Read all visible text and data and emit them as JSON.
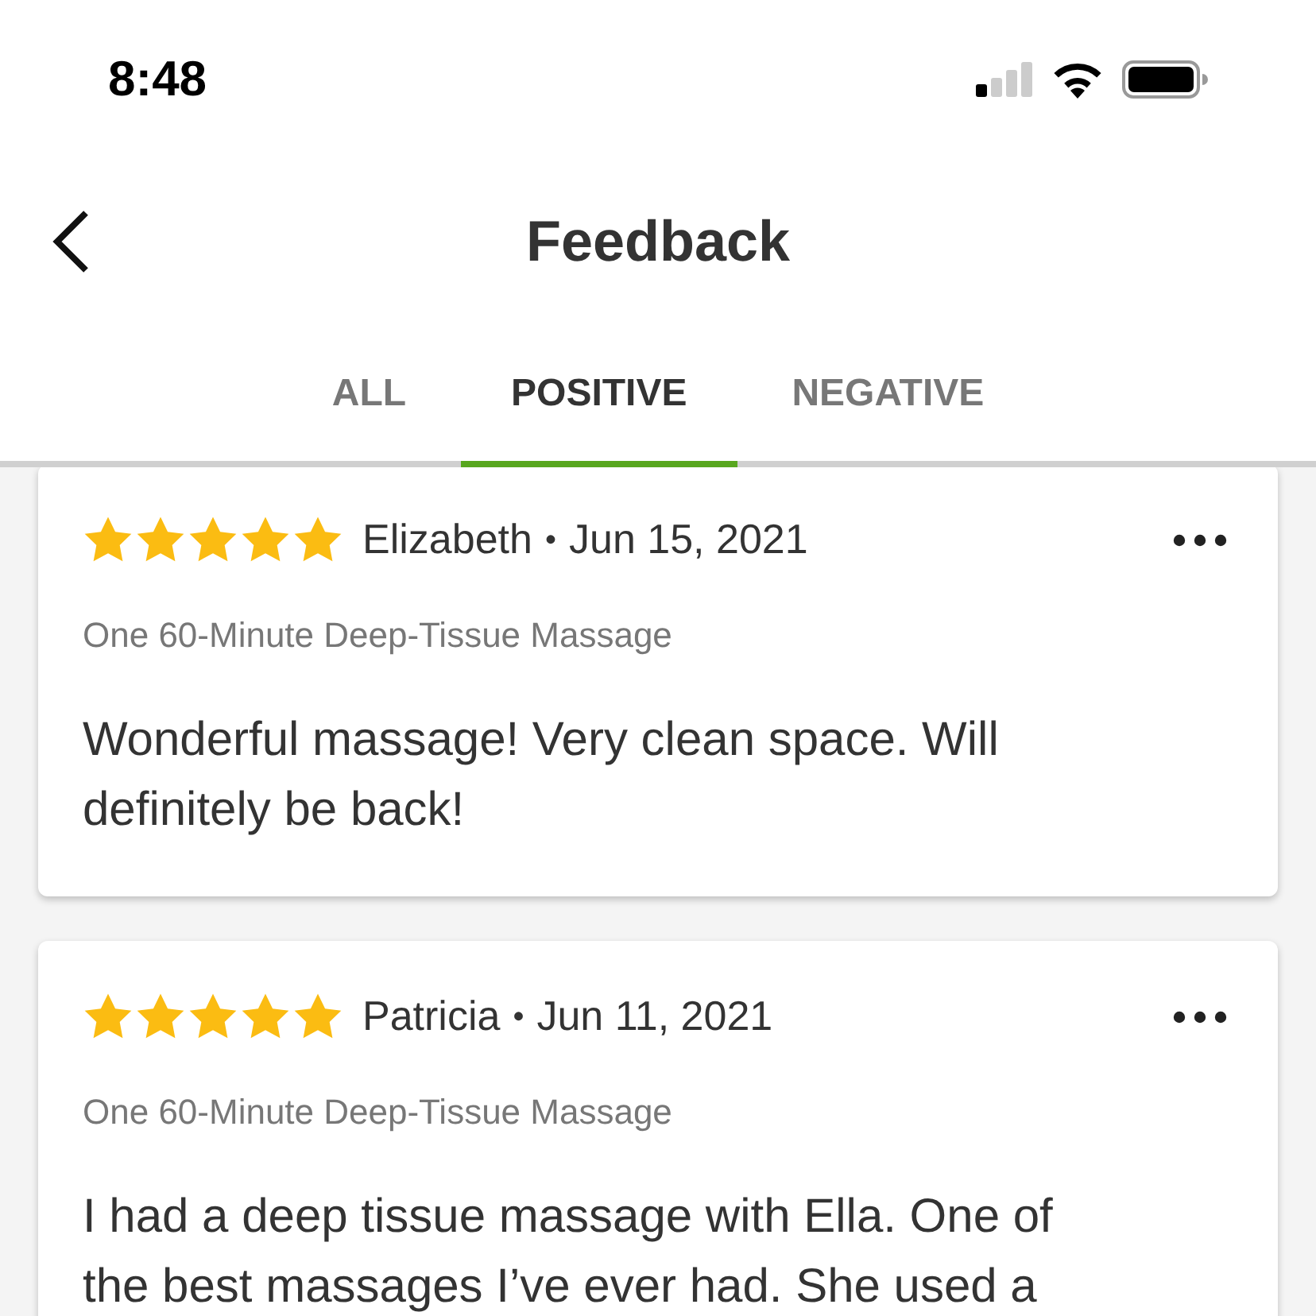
{
  "status_bar": {
    "time": "8:48"
  },
  "header": {
    "title": "Feedback"
  },
  "tabs": [
    {
      "label": "ALL",
      "selected": false
    },
    {
      "label": "POSITIVE",
      "selected": true
    },
    {
      "label": "NEGATIVE",
      "selected": false
    }
  ],
  "reviews": [
    {
      "stars": 5,
      "name": "Elizabeth",
      "separator": "•",
      "date": "Jun 15, 2021",
      "service": "One 60-Minute Deep-Tissue Massage",
      "text": "Wonderful massage! Very clean space. Will definitely be back!"
    },
    {
      "stars": 5,
      "name": "Patricia",
      "separator": "•",
      "date": "Jun 11, 2021",
      "service": "One 60-Minute Deep-Tissue Massage",
      "text": "I had a deep tissue massage with Ella. One of the best massages I’ve ever had. She used a"
    }
  ]
}
